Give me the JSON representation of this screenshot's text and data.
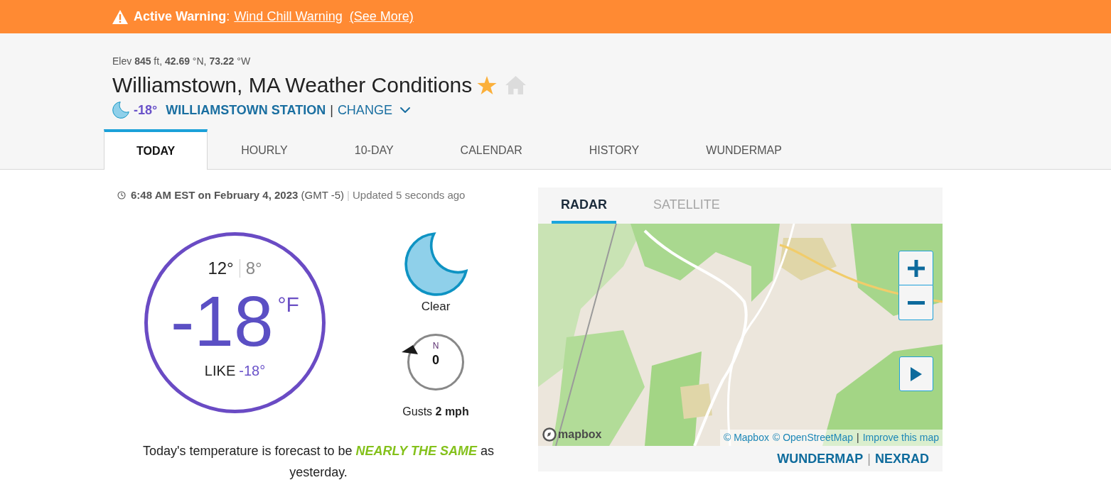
{
  "alert_banner": {
    "label": "**Active Warning**:",
    "warning_link": "Wind Chill Warning",
    "more_link": "(See More)"
  },
  "header": {
    "elevation": "Elev **845** ft, **42.69** °N, **73.22** °W",
    "title": "Williamstown, MA Weather Conditions",
    "favorite": true,
    "home": false,
    "station": {
      "temperature": "-18°",
      "name": "WILLIAMSTOWN STATION",
      "separator": "|",
      "change": "CHANGE"
    }
  },
  "tabs": [
    {
      "label": "TODAY",
      "selected": true
    },
    {
      "label": "HOURLY",
      "selected": false
    },
    {
      "label": "10-DAY",
      "selected": false
    },
    {
      "label": "CALENDAR",
      "selected": false
    },
    {
      "label": "HISTORY",
      "selected": false
    },
    {
      "label": "WUNDERMAP",
      "selected": false
    }
  ],
  "current": {
    "timestamp": "**6:48 AM EST on February 4, 2023** (GMT -5)",
    "separator": "|",
    "updated": "Updated 5 seconds ago",
    "high": "12°",
    "low": "8°",
    "temperature": "-18",
    "unit": "°F",
    "feels_like_label": "LIKE",
    "feels_like": "-18°",
    "condition": "Clear",
    "wind": {
      "direction": "N",
      "speed": "0",
      "gusts": "Gusts **2 mph**"
    },
    "forecast": "Today's temperature is forecast to be **NEARLY THE SAME** as yesterday."
  },
  "map_panel": {
    "tabs": [
      {
        "label": "RADAR",
        "selected": true
      },
      {
        "label": "SATELLITE",
        "selected": false
      }
    ],
    "logo": "mapbox",
    "attribution": [
      "© Mapbox",
      "© OpenStreetMap"
    ],
    "attribution_separator": "|",
    "improve_link": "Improve this map",
    "links": [
      "WUNDERMAP",
      "NEXRAD"
    ],
    "links_separator": "|"
  }
}
